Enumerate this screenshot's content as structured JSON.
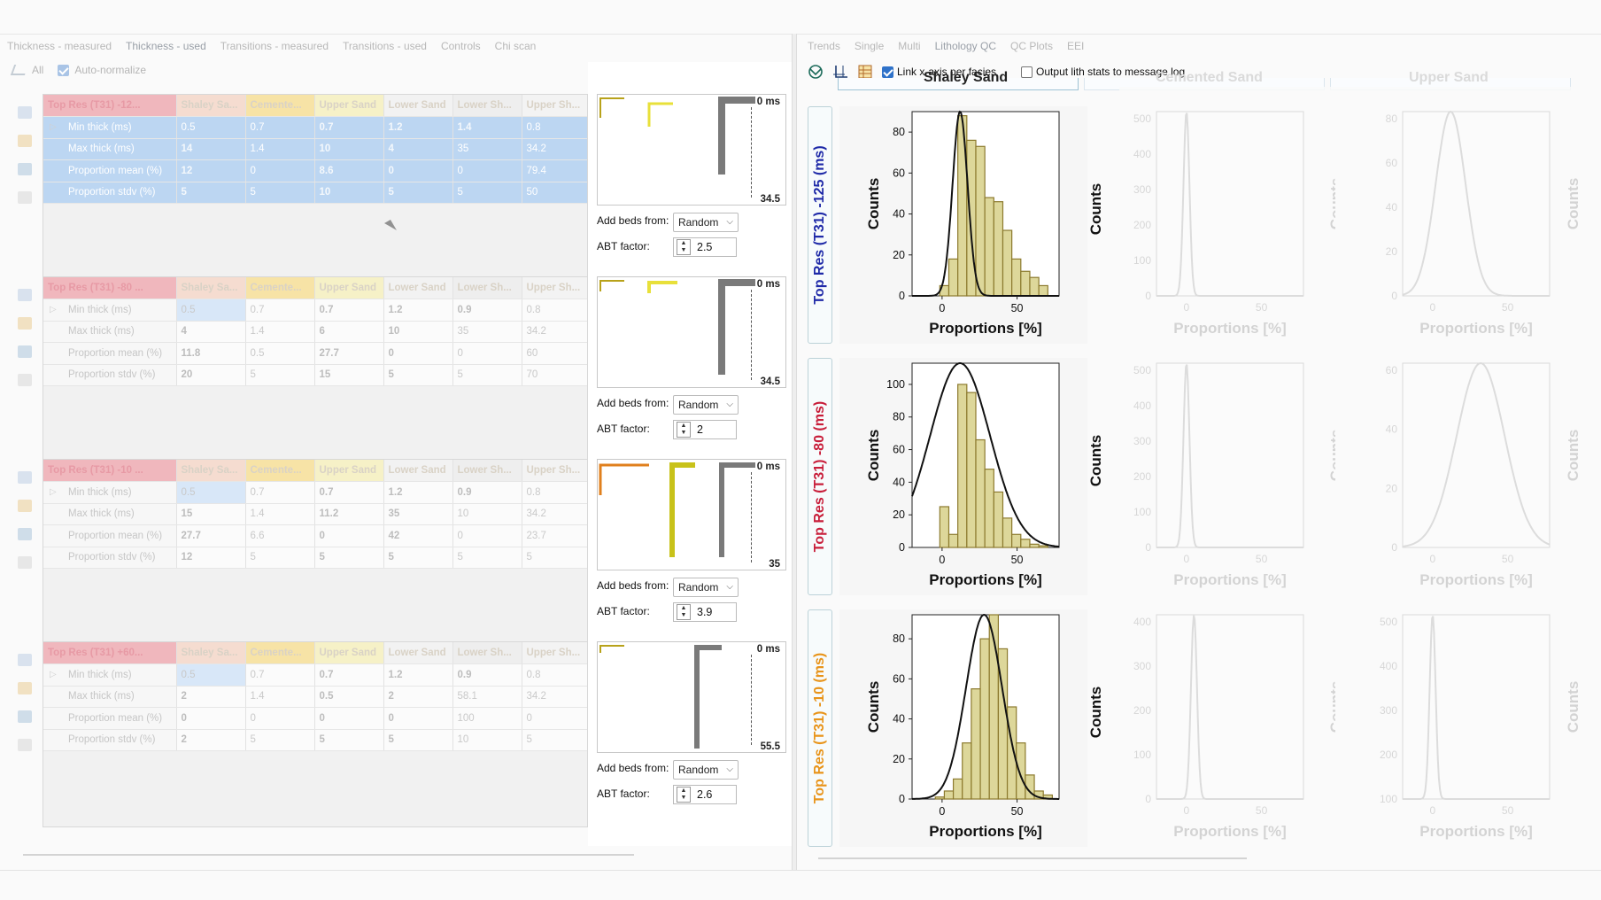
{
  "tabs_left": [
    "Thickness - measured",
    "Thickness - used",
    "Transitions - measured",
    "Transitions - used",
    "Controls",
    "Chi scan"
  ],
  "tabs_right": [
    "Trends",
    "Single",
    "Multi",
    "Lithology QC",
    "QC Plots",
    "EEI"
  ],
  "left_toolbar": {
    "all_label": "All",
    "auto_normalize_label": "Auto-normalize"
  },
  "tables": [
    {
      "title": "Top Res (T31) -12...",
      "columns": [
        "Shaley Sa...",
        "Cemente...",
        "Upper Sand",
        "Lower Sand",
        "Lower Sh...",
        "Upper Sh..."
      ],
      "rows": [
        {
          "label": "Min thick (ms)",
          "values": [
            "0.5",
            "0.7",
            "0.7",
            "1.2",
            "1.4",
            "0.8"
          ]
        },
        {
          "label": "Max thick (ms)",
          "values": [
            "14",
            "1.4",
            "10",
            "4",
            "35",
            "34.2"
          ]
        },
        {
          "label": "Proportion mean (%)",
          "values": [
            "12",
            "0",
            "8.6",
            "0",
            "0",
            "79.4"
          ]
        },
        {
          "label": "Proportion stdv (%)",
          "values": [
            "5",
            "5",
            "10",
            "5",
            "5",
            "50"
          ]
        }
      ]
    },
    {
      "title": "Top Res (T31) -80 ...",
      "columns": [
        "Shaley Sa...",
        "Cemente...",
        "Upper Sand",
        "Lower Sand",
        "Lower Sh...",
        "Upper Sh..."
      ],
      "rows": [
        {
          "label": "Min thick (ms)",
          "values": [
            "0.5",
            "0.7",
            "0.7",
            "1.2",
            "0.9",
            "0.8"
          ]
        },
        {
          "label": "Max thick (ms)",
          "values": [
            "4",
            "1.4",
            "6",
            "10",
            "35",
            "34.2"
          ]
        },
        {
          "label": "Proportion mean (%)",
          "values": [
            "11.8",
            "0.5",
            "27.7",
            "0",
            "0",
            "60"
          ]
        },
        {
          "label": "Proportion stdv (%)",
          "values": [
            "20",
            "5",
            "15",
            "5",
            "5",
            "70"
          ]
        }
      ]
    },
    {
      "title": "Top Res (T31) -10 ...",
      "columns": [
        "Shaley Sa...",
        "Cemente...",
        "Upper Sand",
        "Lower Sand",
        "Lower Sh...",
        "Upper Sh..."
      ],
      "rows": [
        {
          "label": "Min thick (ms)",
          "values": [
            "0.5",
            "0.7",
            "0.7",
            "1.2",
            "0.9",
            "0.8"
          ]
        },
        {
          "label": "Max thick (ms)",
          "values": [
            "15",
            "1.4",
            "11.2",
            "35",
            "10",
            "34.2"
          ]
        },
        {
          "label": "Proportion mean (%)",
          "values": [
            "27.7",
            "6.6",
            "0",
            "42",
            "0",
            "23.7"
          ]
        },
        {
          "label": "Proportion stdv (%)",
          "values": [
            "12",
            "5",
            "5",
            "5",
            "5",
            "5"
          ]
        }
      ]
    },
    {
      "title": "Top Res (T31) +60...",
      "columns": [
        "Shaley Sa...",
        "Cemente...",
        "Upper Sand",
        "Lower Sand",
        "Lower Sh...",
        "Upper Sh..."
      ],
      "rows": [
        {
          "label": "Min thick (ms)",
          "values": [
            "0.5",
            "0.7",
            "0.7",
            "1.2",
            "0.9",
            "0.8"
          ]
        },
        {
          "label": "Max thick (ms)",
          "values": [
            "2",
            "1.4",
            "0.5",
            "2",
            "58.1",
            "34.2"
          ]
        },
        {
          "label": "Proportion mean (%)",
          "values": [
            "0",
            "0",
            "0",
            "0",
            "100",
            "0"
          ]
        },
        {
          "label": "Proportion stdv (%)",
          "values": [
            "2",
            "5",
            "5",
            "5",
            "10",
            "5"
          ]
        }
      ]
    }
  ],
  "header_colors": [
    "#f0b7bd",
    "#f5dcd0",
    "#f7e3a6",
    "#f6f1c7",
    "#f2f2f2",
    "#eeeeee",
    "#f3f3f3"
  ],
  "layer_panels": [
    {
      "top_ms": "0 ms",
      "bottom_ms": "34.5",
      "add_beds_label": "Add beds from:",
      "add_beds_value": "Random",
      "abt_label": "ABT factor:",
      "abt_value": "2.5"
    },
    {
      "top_ms": "0 ms",
      "bottom_ms": "34.5",
      "add_beds_label": "Add beds from:",
      "add_beds_value": "Random",
      "abt_label": "ABT factor:",
      "abt_value": "2"
    },
    {
      "top_ms": "0 ms",
      "bottom_ms": "35",
      "add_beds_label": "Add beds from:",
      "add_beds_value": "Random",
      "abt_label": "ABT factor:",
      "abt_value": "3.9"
    },
    {
      "top_ms": "0 ms",
      "bottom_ms": "55.5",
      "add_beds_label": "Add beds from:",
      "add_beds_value": "Random",
      "abt_label": "ABT factor:",
      "abt_value": "2.6"
    }
  ],
  "right_toolbar": {
    "link_axis_label": "Link x-axis per facies",
    "output_lith_label": "Output lith stats to message log"
  },
  "row_labels": [
    {
      "text": "Top Res (T31) -125 (ms)",
      "color": "#1f2aa8"
    },
    {
      "text": "Top Res (T31) -80 (ms)",
      "color": "#c81e3a"
    },
    {
      "text": "Top Res (T31) -10 (ms)",
      "color": "#e8941a"
    }
  ],
  "column_headers": [
    "Shaley Sand",
    "Cemented Sand",
    "Upper Sand"
  ],
  "hist_colors": {
    "bar_fill": "#ddd79a",
    "bar_stroke": "#8c7a2e",
    "curve": "#111111"
  },
  "chart_data": [
    {
      "type": "bar",
      "xlabel": "Proportions [%]",
      "ylabel": "Counts",
      "x_ticks": [
        "0",
        "50"
      ],
      "y_ticks": [
        "0",
        "20",
        "40",
        "60",
        "80"
      ],
      "ylim": [
        0,
        90
      ],
      "xlim": [
        -20,
        78
      ],
      "bins": [
        -1.5,
        4.5,
        10.5,
        16.5,
        22.5,
        28.5,
        34.5,
        40.5,
        46.5,
        52.5,
        58.5,
        64.5,
        70.5
      ],
      "values": [
        5,
        18,
        88,
        76,
        73,
        48,
        46,
        32,
        18,
        12,
        9,
        5
      ],
      "curve_mean": 12,
      "curve_sd": 5,
      "curve_peak": 90
    },
    {
      "type": "bar",
      "xlabel": "Proportions [%]",
      "ylabel": "Counts",
      "x_ticks": [
        "0",
        "50"
      ],
      "y_ticks": [
        "0",
        "20",
        "40",
        "60",
        "80",
        "100"
      ],
      "ylim": [
        0,
        113
      ],
      "xlim": [
        -20,
        78
      ],
      "bins": [
        -1.5,
        4.5,
        10.5,
        16.5,
        22.5,
        28.5,
        34.5,
        40.5,
        46.5,
        52.5,
        58.5,
        64.5,
        70.5
      ],
      "values": [
        25,
        8,
        100,
        95,
        66,
        48,
        34,
        18,
        8,
        5,
        2,
        1
      ],
      "curve_mean": 12,
      "curve_sd": 20,
      "curve_peak": 113
    },
    {
      "type": "bar",
      "xlabel": "Proportions [%]",
      "ylabel": "Counts",
      "x_ticks": [
        "0",
        "50"
      ],
      "y_ticks": [
        "0",
        "20",
        "40",
        "60",
        "80"
      ],
      "ylim": [
        0,
        92
      ],
      "xlim": [
        -20,
        78
      ],
      "bins": [
        -4.5,
        1.5,
        7.5,
        13.5,
        19.5,
        25.5,
        31.5,
        37.5,
        43.5,
        49.5,
        55.5,
        61.5,
        67.5,
        73.5
      ],
      "values": [
        1,
        4,
        10,
        28,
        55,
        80,
        92,
        75,
        46,
        28,
        12,
        4,
        2
      ],
      "curve_mean": 28,
      "curve_sd": 12,
      "curve_peak": 92
    }
  ],
  "faded_charts": [
    {
      "y_ticks": [
        "0",
        "100",
        "200",
        "300",
        "400",
        "500"
      ],
      "x_ticks": [
        "0",
        "50"
      ],
      "xlabel": "Proportions [%]",
      "ylabel": "Counts"
    },
    {
      "y_ticks": [
        "0",
        "20",
        "40",
        "60",
        "80"
      ],
      "x_ticks": [
        "0",
        "50"
      ],
      "xlabel": "Proportions [%]",
      "ylabel": "Counts"
    },
    {
      "y_ticks": [
        "0",
        "100",
        "200",
        "300",
        "400",
        "500"
      ],
      "x_ticks": [
        "0",
        "50"
      ],
      "xlabel": "Proportions [%]",
      "ylabel": "Counts"
    },
    {
      "y_ticks": [
        "0",
        "20",
        "40",
        "60"
      ],
      "x_ticks": [
        "0",
        "50"
      ],
      "xlabel": "Proportions [%]",
      "ylabel": "Counts"
    },
    {
      "y_ticks": [
        "0",
        "100",
        "200",
        "300",
        "400"
      ],
      "x_ticks": [
        "0",
        "50"
      ],
      "xlabel": "Proportions [%]",
      "ylabel": "Counts"
    },
    {
      "y_ticks": [
        "100",
        "200",
        "300",
        "400",
        "500"
      ],
      "x_ticks": [
        "0",
        "50"
      ],
      "xlabel": "Proportions [%]",
      "ylabel": "Counts"
    }
  ],
  "faded_counts_label": "Counts"
}
